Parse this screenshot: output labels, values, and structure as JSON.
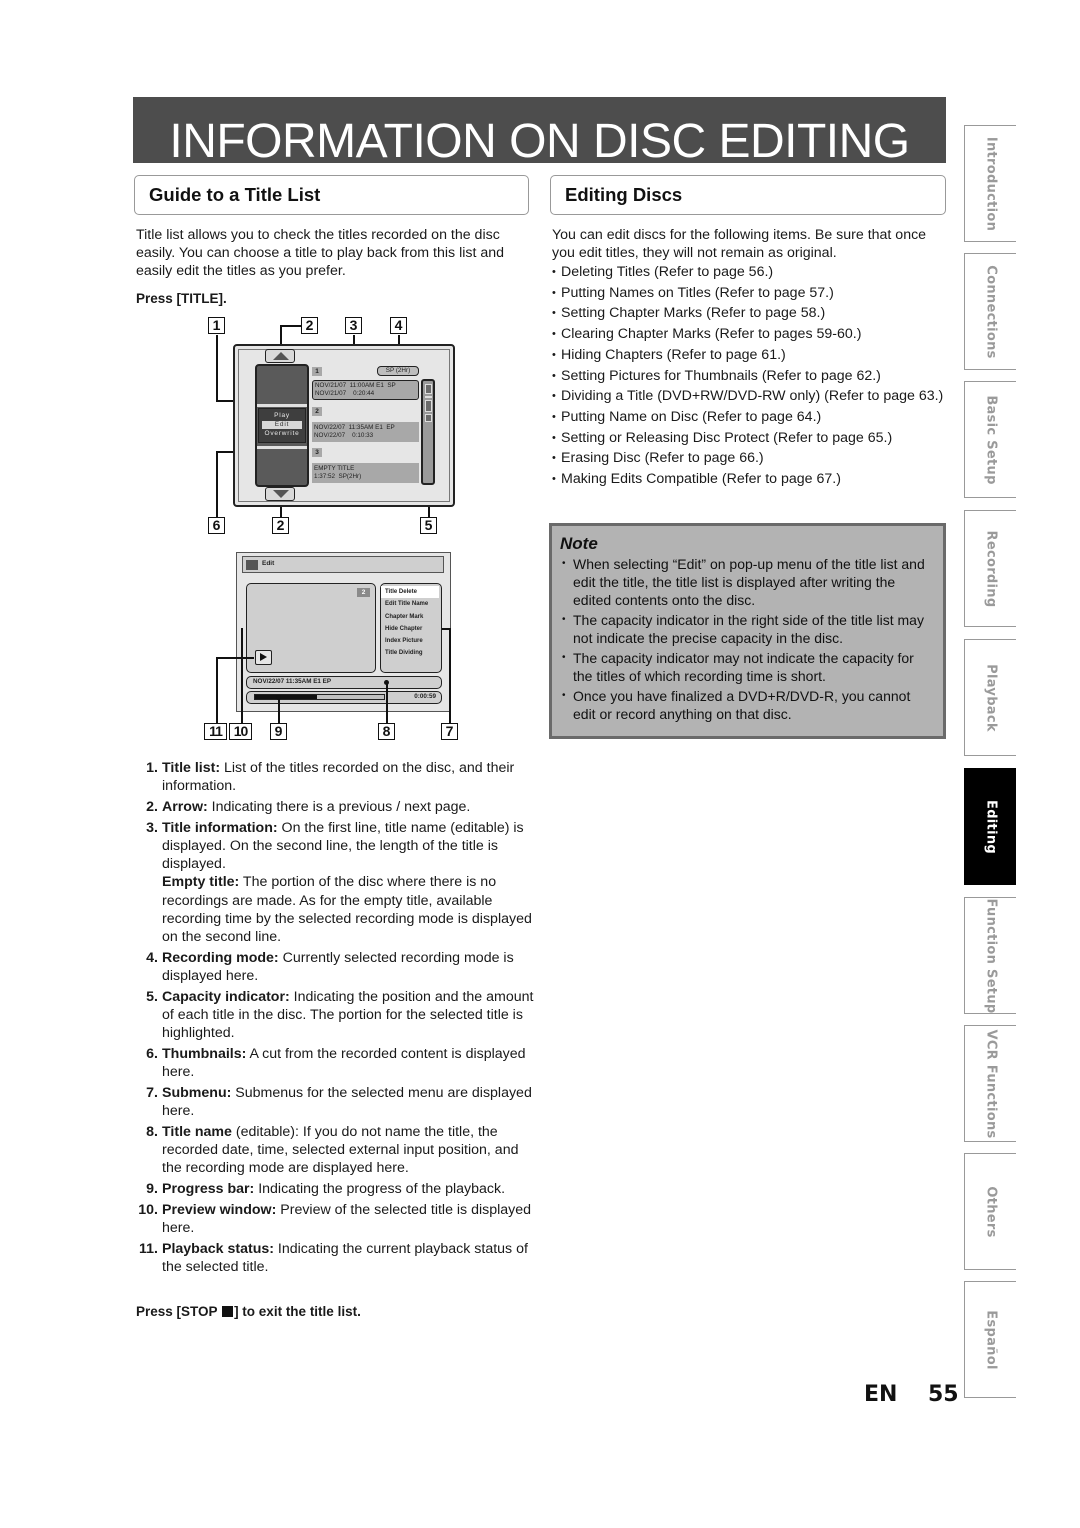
{
  "page": {
    "banner_title": "INFORMATION ON DISC EDITING",
    "language": "EN",
    "page_number": "55"
  },
  "left": {
    "heading": "Guide to a Title List",
    "intro": "Title list allows you to check the titles recorded on the disc easily. You can choose a title to play back from this list and easily edit the titles as you prefer.",
    "press_title": "Press [TITLE].",
    "press_stop_before": "Press [STOP ",
    "press_stop_after": "] to exit the title list."
  },
  "title_list_screen": {
    "callouts_top": [
      "1",
      "2",
      "3",
      "4"
    ],
    "callouts_bottom": [
      "6",
      "2",
      "5"
    ],
    "recording_mode": "SP (2Hr)",
    "popup_menu": [
      "Play",
      "Edit",
      "Overwrite"
    ],
    "popup_selected": "Edit",
    "titles": [
      {
        "number": "1",
        "line1": "NOV/21/07  11:00AM E1  SP",
        "line2": "NOV/21/07    0:20:44",
        "selected": true
      },
      {
        "number": "2",
        "line1": "NOV/22/07  11:35AM E1  EP",
        "line2": "NOV/22/07    0:10:33",
        "selected": false
      },
      {
        "number": "3",
        "line1": "EMPTY TITLE",
        "line2": "1:37:52  SP(2Hr)",
        "selected": false
      }
    ]
  },
  "edit_screen": {
    "callouts": [
      "11",
      "10",
      "9",
      "8",
      "7"
    ],
    "header_label": "Edit",
    "preview_title_number": "2",
    "submenu": [
      "Title Delete",
      "Edit Title Name",
      "Chapter Mark",
      "Hide Chapter",
      "Index Picture",
      "Title Dividing"
    ],
    "submenu_selected": "Title Delete",
    "title_name": "NOV/22/07 11:35AM E1 EP",
    "elapsed_time": "0:00:59",
    "progress_fraction": 0.48,
    "playback_status": "play"
  },
  "definitions": [
    {
      "num": "1.",
      "term": "Title list:",
      "text": " List of the titles recorded on the disc, and their information."
    },
    {
      "num": "2.",
      "term": "Arrow:",
      "text": " Indicating there is a previous / next page."
    },
    {
      "num": "3.",
      "term": "Title information:",
      "text": " On the first line, title name (editable) is displayed. On the second line, the length of the title is displayed.",
      "sub_term": "Empty title:",
      "sub_text": " The portion of the disc where there is no recordings are made. As for the empty title, available recording time by the selected recording mode is displayed on the second line."
    },
    {
      "num": "4.",
      "term": "Recording mode:",
      "text": " Currently selected recording mode is displayed here."
    },
    {
      "num": "5.",
      "term": "Capacity indicator:",
      "text": " Indicating the position and the amount of each title in the disc. The portion for the selected title is highlighted."
    },
    {
      "num": "6.",
      "term": "Thumbnails:",
      "text": " A cut from the recorded content is displayed here."
    },
    {
      "num": "7.",
      "term": "Submenu:",
      "text": " Submenus for the selected menu are displayed here."
    },
    {
      "num": "8.",
      "term": "Title name",
      "text": " (editable): If you do not name the title, the recorded date, time, selected external input position, and the recording mode are displayed here."
    },
    {
      "num": "9.",
      "term": "Progress bar:",
      "text": " Indicating the progress of the playback."
    },
    {
      "num": "10.",
      "term": "Preview window:",
      "text": " Preview of the selected title is displayed here."
    },
    {
      "num": "11.",
      "term": "Playback status:",
      "text": " Indicating the current playback status of the selected title."
    }
  ],
  "right": {
    "heading": "Editing Discs",
    "intro": "You can edit discs for the following items. Be sure that once you edit titles, they will not remain as original.",
    "items": [
      "Deleting Titles (Refer to page 56.)",
      "Putting Names on Titles (Refer to page 57.)",
      "Setting Chapter Marks (Refer to page 58.)",
      "Clearing Chapter Marks (Refer to pages 59-60.)",
      "Hiding Chapters (Refer to page 61.)",
      "Setting Pictures for Thumbnails (Refer to page 62.)",
      "Dividing a Title (DVD+RW/DVD-RW only) (Refer to page 63.)",
      "Putting Name on Disc (Refer to page 64.)",
      "Setting or Releasing Disc Protect (Refer to page 65.)",
      "Erasing Disc (Refer to page 66.)",
      "Making Edits Compatible (Refer to page 67.)"
    ]
  },
  "note": {
    "title": "Note",
    "items": [
      "When selecting “Edit” on pop-up menu of the title list and edit the title, the title list is displayed after writing the edited contents onto the disc.",
      "The capacity indicator in the right side of the title list may not indicate the precise capacity in the disc.",
      "The capacity indicator may not indicate the capacity for the titles of which recording time is short.",
      "Once you have finalized a DVD+R/DVD-R, you cannot edit or record anything on that disc."
    ]
  },
  "side_tabs": [
    {
      "label": "Introduction",
      "active": false
    },
    {
      "label": "Connections",
      "active": false
    },
    {
      "label": "Basic Setup",
      "active": false
    },
    {
      "label": "Recording",
      "active": false
    },
    {
      "label": "Playback",
      "active": false
    },
    {
      "label": "Editing",
      "active": true
    },
    {
      "label": "Function Setup",
      "active": false
    },
    {
      "label": "VCR Functions",
      "active": false
    },
    {
      "label": "Others",
      "active": false
    },
    {
      "label": "Español",
      "active": false
    }
  ],
  "colors": {
    "banner_bg": "#4d4d4d",
    "note_bg": "#b3b3b3",
    "note_border": "#6a6a6a",
    "active_tab": "#000000",
    "inactive_tab_text": "#9a9a9a"
  }
}
